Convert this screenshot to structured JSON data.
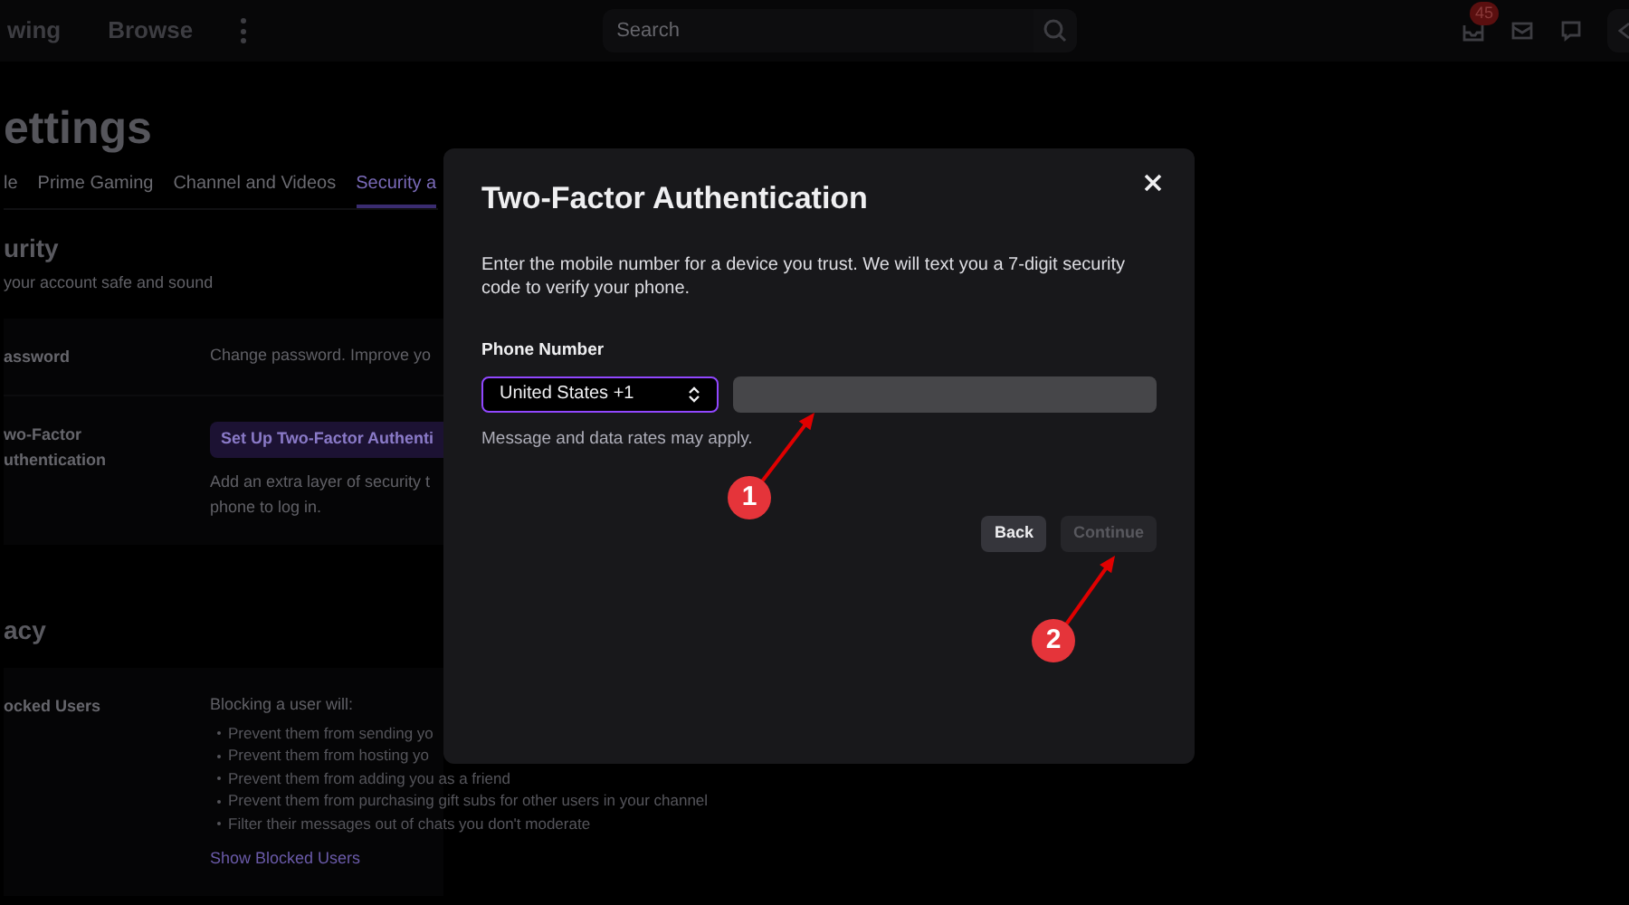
{
  "top_nav": {
    "links": [
      "wing",
      "Browse"
    ],
    "search": {
      "placeholder": "Search"
    },
    "notification_count": "45"
  },
  "page": {
    "title": "ettings",
    "tabs": [
      {
        "label": "le",
        "selected": false
      },
      {
        "label": "Prime Gaming",
        "selected": false
      },
      {
        "label": "Channel and Videos",
        "selected": false
      },
      {
        "label": "Security a",
        "selected": true
      }
    ],
    "sections": [
      {
        "title": "urity",
        "subtitle": "your account safe and sound",
        "rows": [
          {
            "kind": "text",
            "label": [
              "assword"
            ],
            "lines": [
              "Change password. Improve yo"
            ]
          },
          {
            "kind": "button",
            "label": [
              "wo-Factor",
              "uthentication"
            ],
            "button": "Set Up Two-Factor Authenti",
            "lines": [
              "Add an extra layer of security t",
              "phone to log in."
            ]
          }
        ]
      },
      {
        "title": "acy",
        "rows": [
          {
            "kind": "list",
            "label": [
              "ocked Users"
            ],
            "intro": "Blocking a user will:",
            "bullets": [
              "Prevent them from sending yo",
              "Prevent them from hosting yo",
              "Prevent them from adding you as a friend",
              "Prevent them from purchasing gift subs for other users in your channel",
              "Filter their messages out of chats you don't moderate"
            ],
            "link": "Show Blocked Users"
          }
        ]
      }
    ]
  },
  "modal": {
    "title": "Two-Factor Authentication",
    "description": "Enter the mobile number for a device you trust. We will text you a 7-digit security code to verify your phone.",
    "field_label": "Phone Number",
    "country_select": "United States +1",
    "note": "Message and data rates may apply.",
    "buttons": [
      {
        "label": "Back",
        "disabled": false
      },
      {
        "label": "Continue",
        "disabled": true
      }
    ]
  },
  "annotations": [
    {
      "label": "1"
    },
    {
      "label": "2"
    }
  ]
}
